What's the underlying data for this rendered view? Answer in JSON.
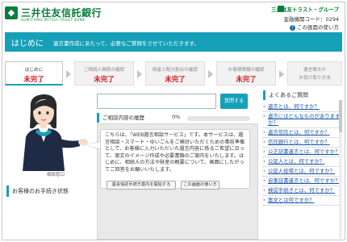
{
  "header": {
    "logo_mark": "◆",
    "bank_name": "三井住友信託銀行",
    "bank_name_en": "SUMITOMO MITSUI TRUST BANK",
    "group_name": "三井住友トラスト・グループ",
    "branch_label": "金融機関コード：0294",
    "help_icon": "?",
    "help_label": "この画面の使い方"
  },
  "titlebar": {
    "title": "はじめに",
    "description": "遺言書作成にあたって、必要なご質問をさせていただきます。"
  },
  "steps": [
    {
      "label": "はじめに",
      "status": "未完了"
    },
    {
      "label": "ご相続人関係の確認",
      "status": "未完了"
    },
    {
      "label": "財産と配分割合の確認",
      "status": "未完了"
    },
    {
      "label": "お客様情報の確認",
      "status": "未完了"
    },
    {
      "label": "遺言案文の",
      "status": "お受け取り方法"
    }
  ],
  "avatar": {
    "label": "相談窓口"
  },
  "status_section": {
    "title": "お客様のお手続き状態"
  },
  "consult": {
    "placeholder": "",
    "send_label": "質問する"
  },
  "history": {
    "title": "ご相談内容の履歴",
    "progress_text": "0%",
    "progress_value": 0
  },
  "bubble": {
    "text": "こちらは、「WEB遺言相談サービス」です。本サービスは、遺言相談・スマート・ゆいごんをご検討いただくための事前準備として、お客様に入力いただいた遺言内容に係るご希望に沿って、案文のイメージ作成や必要書類のご案内をいたします。はじめに、相続人の方法や財産の概要について、画面にしたがってご回答をお願いいたします。",
    "btn_left": "遺言信託手続き案内を開始する",
    "btn_right": "この画面の使い方"
  },
  "faq": {
    "title": "よくあるご質問",
    "items": [
      "遺言とは、何ですか？",
      "遺言にはどんなものがありますか？",
      "遺言信託とは、何ですか？",
      "信託銀行とは、何ですか？",
      "公正証書遺言とは、何ですか？",
      "公証人とは、何ですか？",
      "公証人役場とは、何ですか？",
      "自筆証書遺言とは、何ですか？",
      "検認手続きとは、何ですか？",
      "案文とは何ですか？"
    ]
  },
  "colors": {
    "brand_green": "#0a7d3b",
    "accent_teal": "#16a0b8",
    "status_red": "#d4141c",
    "link_blue": "#1a55a8"
  }
}
